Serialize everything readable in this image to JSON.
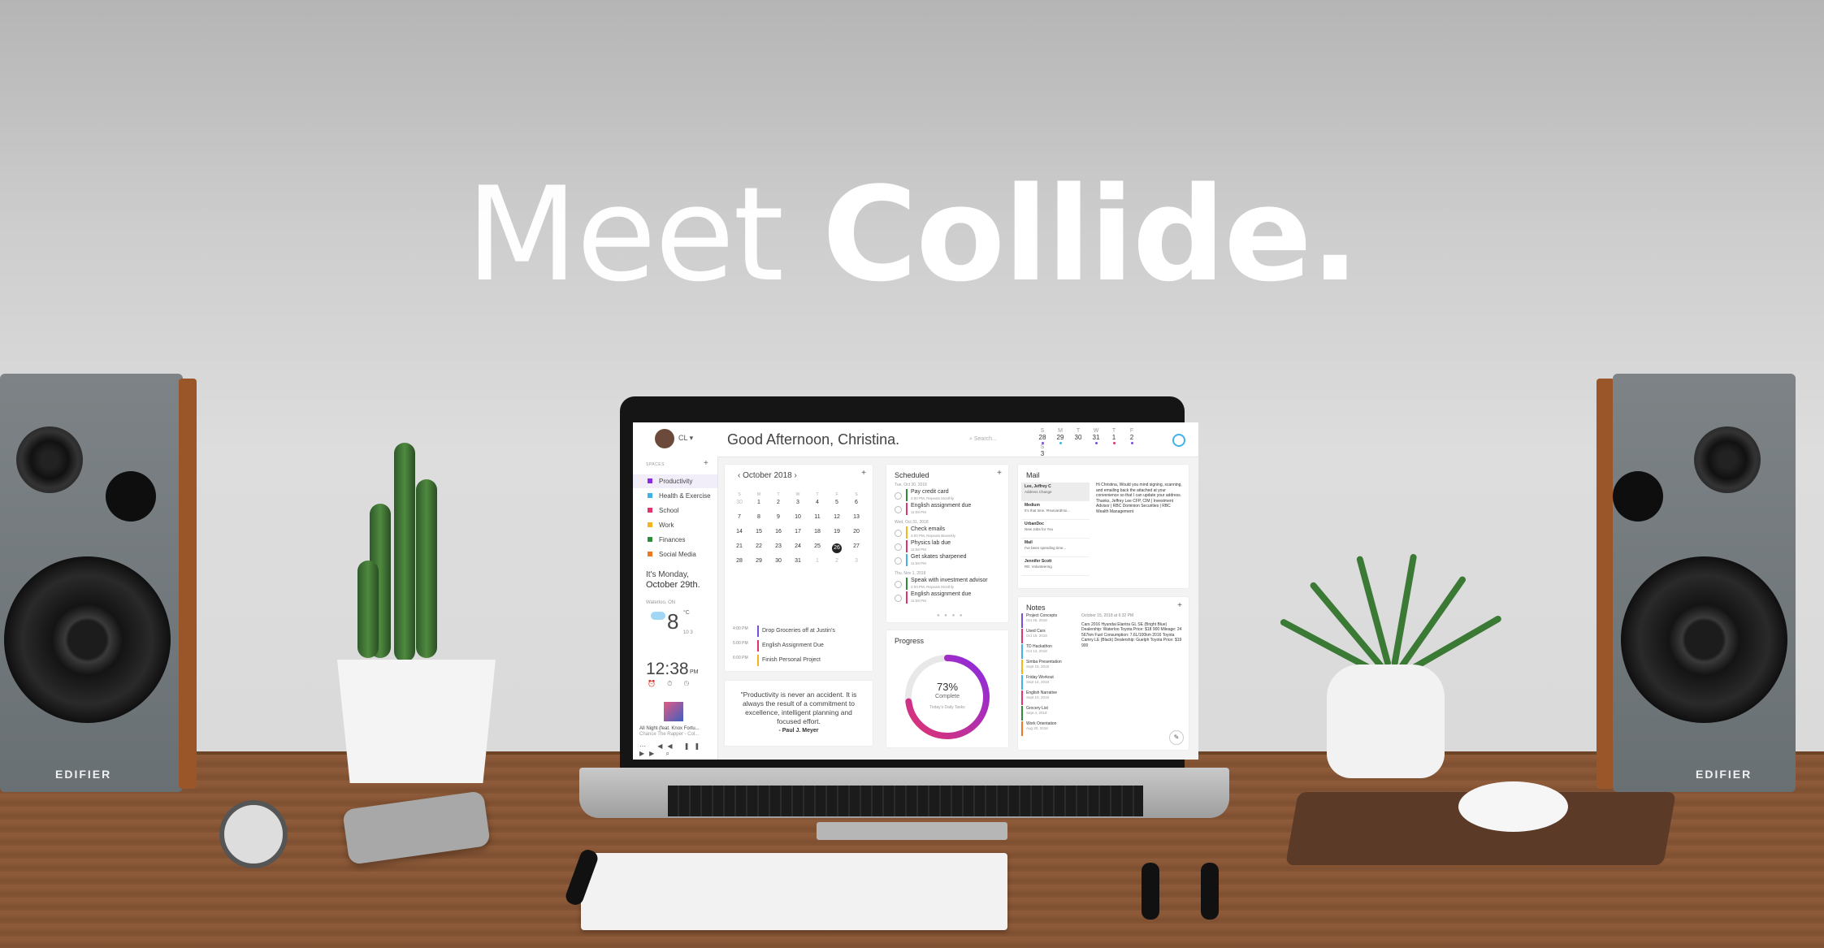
{
  "headline": {
    "light": "Meet ",
    "bold": "Collide."
  },
  "speakers": {
    "brand": "EDIFIER"
  },
  "app": {
    "user_initials": "CL ▾",
    "greeting": "Good Afternoon, Christina.",
    "search_placeholder": "Search...",
    "week": [
      {
        "l": "S",
        "n": "28",
        "color": "#7b4fd6"
      },
      {
        "l": "M",
        "n": "29",
        "color": "#3fb3e8"
      },
      {
        "l": "T",
        "n": "30",
        "color": ""
      },
      {
        "l": "W",
        "n": "31",
        "color": "#7b4fd6"
      },
      {
        "l": "T",
        "n": "1",
        "color": "#e0336f"
      },
      {
        "l": "F",
        "n": "2",
        "color": "#7b4fd6"
      },
      {
        "l": "S",
        "n": "3",
        "color": ""
      }
    ],
    "sidebar": {
      "header": "SPACES",
      "items": [
        {
          "label": "Productivity",
          "color": "#8a2be2"
        },
        {
          "label": "Health & Exercise",
          "color": "#3fb3e8"
        },
        {
          "label": "School",
          "color": "#e0336f"
        },
        {
          "label": "Work",
          "color": "#f2b61c"
        },
        {
          "label": "Finances",
          "color": "#2e8b3a"
        },
        {
          "label": "Social Media",
          "color": "#f2771c"
        }
      ],
      "date_line1": "It's Monday,",
      "date_line2": "October 29th.",
      "location": "Waterloo, ON",
      "temp": "8",
      "temp_unit": "°C",
      "temp_small": "10  3",
      "time": "12:38",
      "ampm": "PM",
      "icons": "⏰ ⏱ ◷",
      "song": "All Night (feat. Knox Fortu...",
      "artist": "Chance The Rapper - Col...",
      "controls": "⋯ ◀◀ ❚❚ ▶▶ ⌕"
    },
    "calendar": {
      "month": "October 2018",
      "day_names": [
        "S",
        "M",
        "T",
        "W",
        "T",
        "F",
        "S"
      ],
      "weeks": [
        [
          "30",
          "1",
          "2",
          "3",
          "4",
          "5",
          "6"
        ],
        [
          "7",
          "8",
          "9",
          "10",
          "11",
          "12",
          "13"
        ],
        [
          "14",
          "15",
          "16",
          "17",
          "18",
          "19",
          "20"
        ],
        [
          "21",
          "22",
          "23",
          "24",
          "25",
          "26",
          "27"
        ],
        [
          "28",
          "29",
          "30",
          "31",
          "1",
          "2",
          "3"
        ]
      ],
      "events": [
        {
          "time": "4:00 PM",
          "title": "Drop Groceries off at Justin's",
          "color": "#7b4fd6"
        },
        {
          "time": "5:00 PM",
          "title": "English Assignment Due",
          "color": "#e0336f"
        },
        {
          "time": "6:00 PM",
          "title": "Finish Personal Project",
          "color": "#f2b61c"
        }
      ]
    },
    "quote": {
      "text": "\"Productivity is never an accident. It is always the result of a commitment to excellence, intelligent planning and focused effort.",
      "author": "- Paul J. Meyer"
    },
    "scheduled": {
      "title": "Scheduled",
      "groups": [
        {
          "date": "Tue, Oct 30, 2018",
          "items": [
            {
              "title": "Pay credit card",
              "sub": "4:00 PM, Repeats Monthly",
              "color": "#2e8b3a"
            },
            {
              "title": "English assignment due",
              "sub": "11:59 PM",
              "color": "#e0336f"
            }
          ]
        },
        {
          "date": "Wed, Oct 31, 2018",
          "items": [
            {
              "title": "Check emails",
              "sub": "4:00 PM, Repeats Biweekly",
              "color": "#f2b61c"
            },
            {
              "title": "Physics lab due",
              "sub": "11:59 PM",
              "color": "#e0336f"
            },
            {
              "title": "Get skates sharpened",
              "sub": "11:59 PM",
              "color": "#3fb3e8"
            }
          ]
        },
        {
          "date": "Thu, Nov 1, 2018",
          "items": [
            {
              "title": "Speak with investment advisor",
              "sub": "4:00 PM, Repeats Monthly",
              "color": "#2e8b3a"
            },
            {
              "title": "English assignment due",
              "sub": "11:59 PM",
              "color": "#e0336f"
            }
          ]
        }
      ]
    },
    "progress": {
      "title": "Progress",
      "percent": 73,
      "percent_label": "73%",
      "complete_label": "Complete",
      "sub": "Today's Daily Tasks"
    },
    "mail": {
      "title": "Mail",
      "list": [
        {
          "from": "Lee, Jeffrey C",
          "subject": "Address Change",
          "selected": true
        },
        {
          "from": "Medium",
          "subject": "It's that time. #HarvardInsi..."
        },
        {
          "from": "UrbanDoc",
          "subject": "New Jobs for You"
        },
        {
          "from": "Mail",
          "subject": "I've been spending time..."
        },
        {
          "from": "Jennifer Scott",
          "subject": "RE: Volunteering"
        }
      ],
      "body": "Hi Christina, Would you mind signing, scanning, and emailing back the attached at your convenience so that I can update your address. Thanks, Jeffrey Lee CFP, CIM | Investment Advisor | RBC Dominion Securities | RBC Wealth Management"
    },
    "notes": {
      "title": "Notes",
      "list": [
        {
          "title": "Project Concepts",
          "date": "Oct 26, 2018",
          "color": "#7b4fd6"
        },
        {
          "title": "Used Cars",
          "date": "Oct 15, 2018",
          "color": "#e0336f"
        },
        {
          "title": "TD Hackathon",
          "date": "Oct 13, 2018",
          "color": "#3fb3e8"
        },
        {
          "title": "Simba Presentation",
          "date": "Sept 15, 2018",
          "color": "#f2b61c"
        },
        {
          "title": "Friday Workout",
          "date": "Sept 14, 2018",
          "color": "#3fb3e8"
        },
        {
          "title": "English Narrative",
          "date": "Sept 10, 2018",
          "color": "#e0336f"
        },
        {
          "title": "Grocery List",
          "date": "Sept 4, 2018",
          "color": "#2e8b3a"
        },
        {
          "title": "Work Orientation",
          "date": "Aug 20, 2018",
          "color": "#f2771c"
        }
      ],
      "body_date": "October 15, 2018 at 6:32 PM",
      "body": "Cars  2016 Hyundai Elantra GL SE (Bright Blue)  Dealership: Waterloo Toyota  Price: $18 900  Mileage: 24 567km  Fuel Consumption: 7.6L/100km  2016 Toyota Camry LE (Black)  Dealership: Guelph Toyota  Price: $19 900"
    }
  }
}
